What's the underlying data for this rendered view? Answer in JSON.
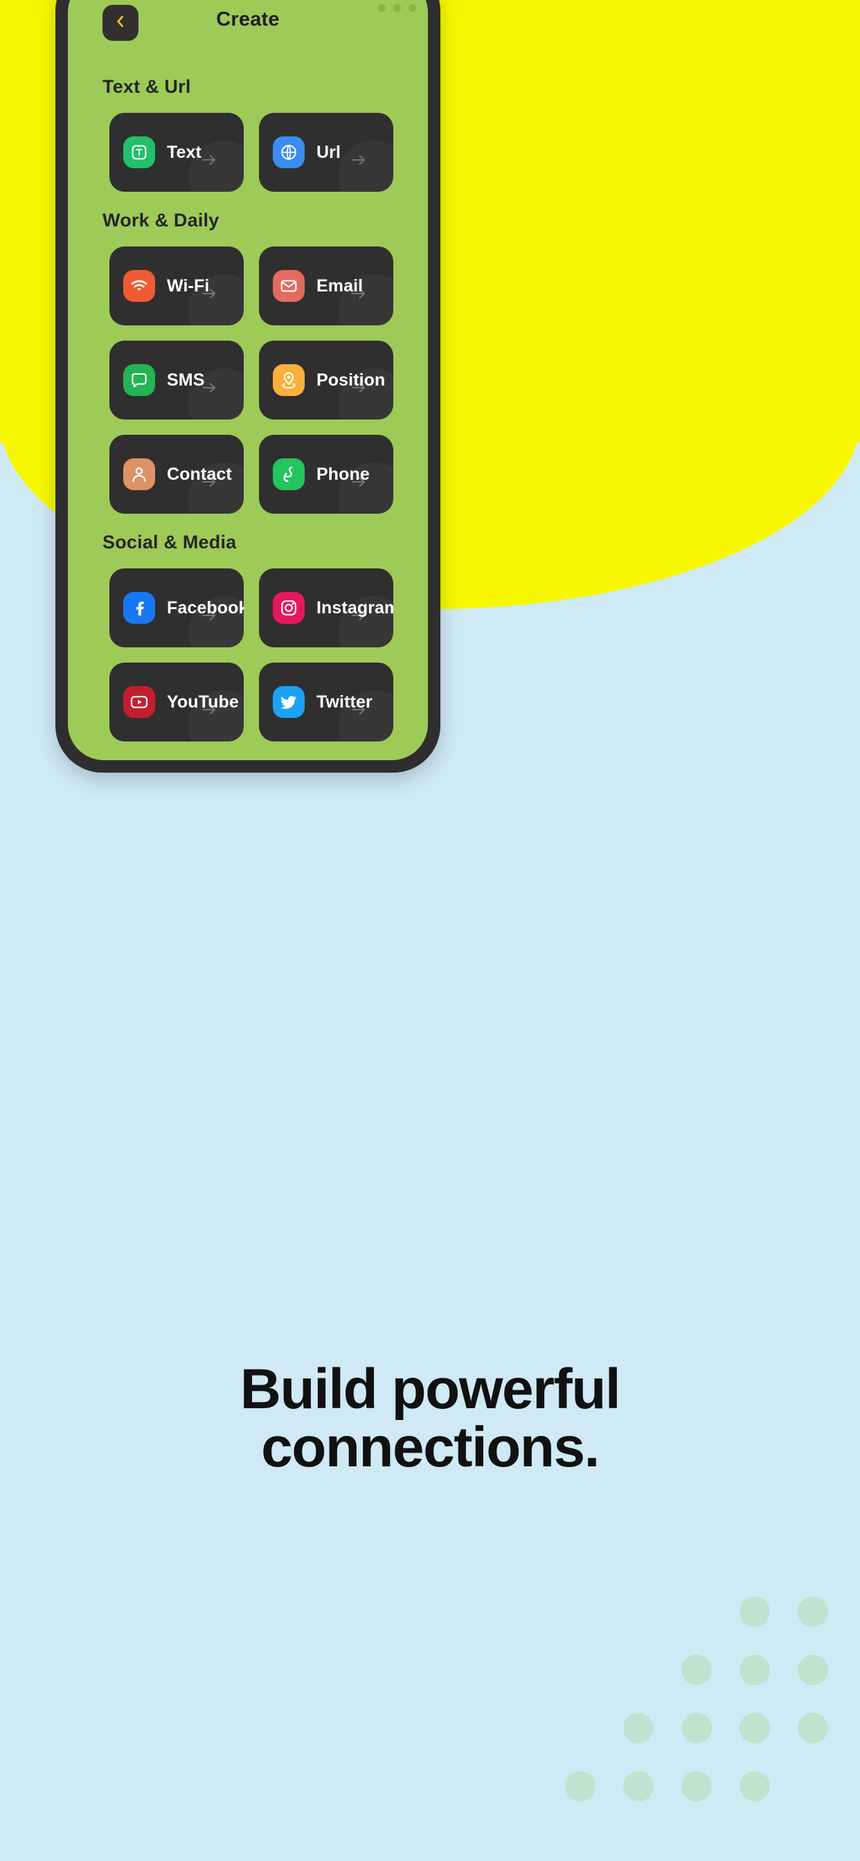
{
  "theme": {
    "background_light": "#CFEAF5",
    "background_yellow": "#F7F800",
    "phone_frame": "#2E2E2E",
    "app_screen_green": "#9ECA58",
    "card_dark": "#2F2F2F",
    "card_label_color": "#FFFFFF",
    "section_title_color": "#262626",
    "back_arrow_accent": "#F7B733",
    "tagline_color": "#111111",
    "dot_color": "#BDE0C8"
  },
  "appbar": {
    "title": "Create",
    "back_icon": "chevron-left-icon"
  },
  "sections": [
    {
      "title": "Text & Url",
      "items": [
        {
          "label": "Text",
          "icon": "text-icon",
          "color": "#22C06A"
        },
        {
          "label": "Url",
          "icon": "globe-icon",
          "color": "#3B8DF0"
        }
      ]
    },
    {
      "title": "Work & Daily",
      "items": [
        {
          "label": "Wi-Fi",
          "icon": "wifi-icon",
          "color": "#F05A34"
        },
        {
          "label": "Email",
          "icon": "envelope-icon",
          "color": "#E36A5E"
        },
        {
          "label": "SMS",
          "icon": "chat-icon",
          "color": "#22B455"
        },
        {
          "label": "Position",
          "icon": "location-icon",
          "color": "#FBB03B"
        },
        {
          "label": "Contact",
          "icon": "person-icon",
          "color": "#DD9366"
        },
        {
          "label": "Phone",
          "icon": "phone-icon",
          "color": "#22C55E"
        }
      ]
    },
    {
      "title": "Social & Media",
      "items": [
        {
          "label": "Facebook",
          "icon": "facebook-icon",
          "color": "#1877F2"
        },
        {
          "label": "Instagram",
          "icon": "instagram-icon",
          "color": "#E8175D"
        },
        {
          "label": "YouTube",
          "icon": "youtube-icon",
          "color": "#C41E2E"
        },
        {
          "label": "Twitter",
          "icon": "twitter-icon",
          "color": "#1DA1F2"
        }
      ]
    }
  ],
  "card_arrow_icon": "arrow-right-icon",
  "tagline": {
    "line1": "Build powerful",
    "line2": "connections."
  }
}
